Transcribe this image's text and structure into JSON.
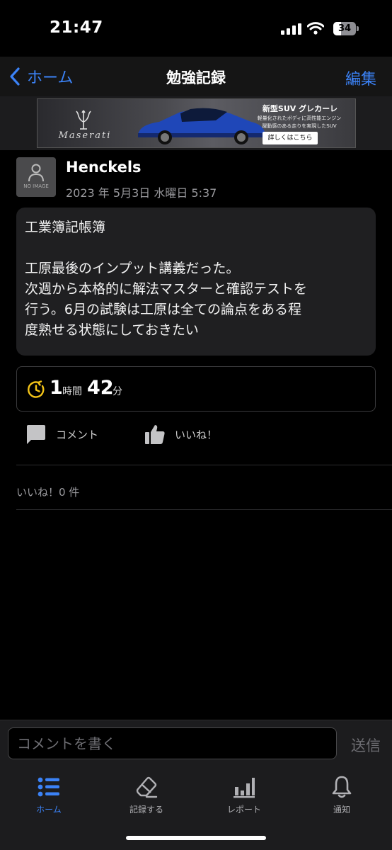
{
  "status": {
    "time": "21:47",
    "battery": "34"
  },
  "nav": {
    "back_label": "ホーム",
    "title": "勉強記録",
    "edit_label": "編集"
  },
  "ad": {
    "brand": "Maserati",
    "headline": "新型SUV グレカーレ",
    "sub1": "軽量化されたボディに高性能エンジン",
    "sub2": "躍動感のある走りを実現したSUV",
    "cta": "詳しくはこちら"
  },
  "post": {
    "avatar_label": "NO IMAGE",
    "username": "Henckels",
    "date": "2023 年 5月3日 水曜日 5:37",
    "body_lines": [
      "工業簿記帳簿",
      "",
      "工原最後のインプット講義だった。",
      "次週から本格的に解法マスターと確認テストを",
      "行う。6月の試験は工原は全ての論点をある程",
      "度熟せる状態にしておきたい"
    ],
    "duration": {
      "hours": "1",
      "hours_unit": "時間",
      "minutes": "42",
      "minutes_unit": "分"
    }
  },
  "actions": {
    "comment_label": "コメント",
    "like_label": "いいね！"
  },
  "likes": {
    "count_label": "いいね！0 件"
  },
  "comment_bar": {
    "placeholder": "コメントを書く",
    "send_label": "送信"
  },
  "tabs": [
    {
      "label": "ホーム",
      "icon": "list-icon",
      "active": true
    },
    {
      "label": "記録する",
      "icon": "eraser-icon",
      "active": false
    },
    {
      "label": "レポート",
      "icon": "bar-chart-icon",
      "active": false
    },
    {
      "label": "通知",
      "icon": "bell-icon",
      "active": false
    }
  ],
  "colors": {
    "accent": "#3b82f6",
    "clock": "#f5c518",
    "background": "#000000"
  }
}
